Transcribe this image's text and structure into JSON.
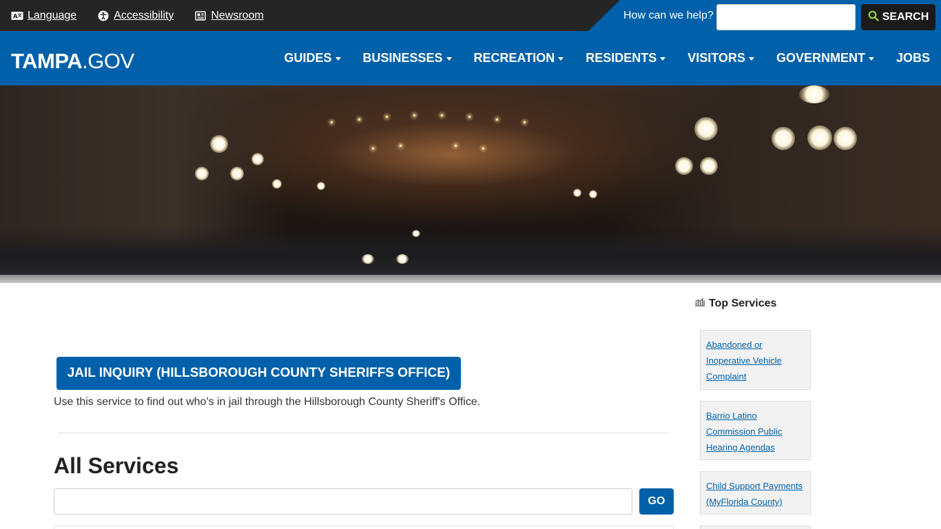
{
  "utility": {
    "language": "Language",
    "accessibility": "Accessibility",
    "newsroom": "Newsroom",
    "search_label": "How can we help?",
    "search_value": "",
    "search_button": "SEARCH"
  },
  "logo": {
    "bold": "TAMPA",
    "light": ".GOV"
  },
  "nav": [
    {
      "label": "GUIDES"
    },
    {
      "label": "BUSINESSES"
    },
    {
      "label": "RECREATION"
    },
    {
      "label": "RESIDENTS"
    },
    {
      "label": "VISITORS"
    },
    {
      "label": "GOVERNMENT"
    },
    {
      "label": "JOBS"
    }
  ],
  "main": {
    "jail_button": "JAIL INQUIRY (HILLSBOROUGH COUNTY SHERIFFS OFFICE)",
    "jail_description": "Use this service to find out who's in jail through the Hillsborough County Sheriff's Office.",
    "all_services_title": "All Services",
    "services_input_value": "",
    "go_button": "GO"
  },
  "sidebar": {
    "title": "Top Services",
    "services": [
      {
        "label": "Abandoned or Inoperative Vehicle Complaint"
      },
      {
        "label": "Barrio Latino Commission Public Hearing Agendas"
      },
      {
        "label": "Child Support Payments (MyFlorida County)"
      }
    ]
  },
  "colors": {
    "brand_blue": "#0061aa",
    "utility_dark": "#252525"
  }
}
